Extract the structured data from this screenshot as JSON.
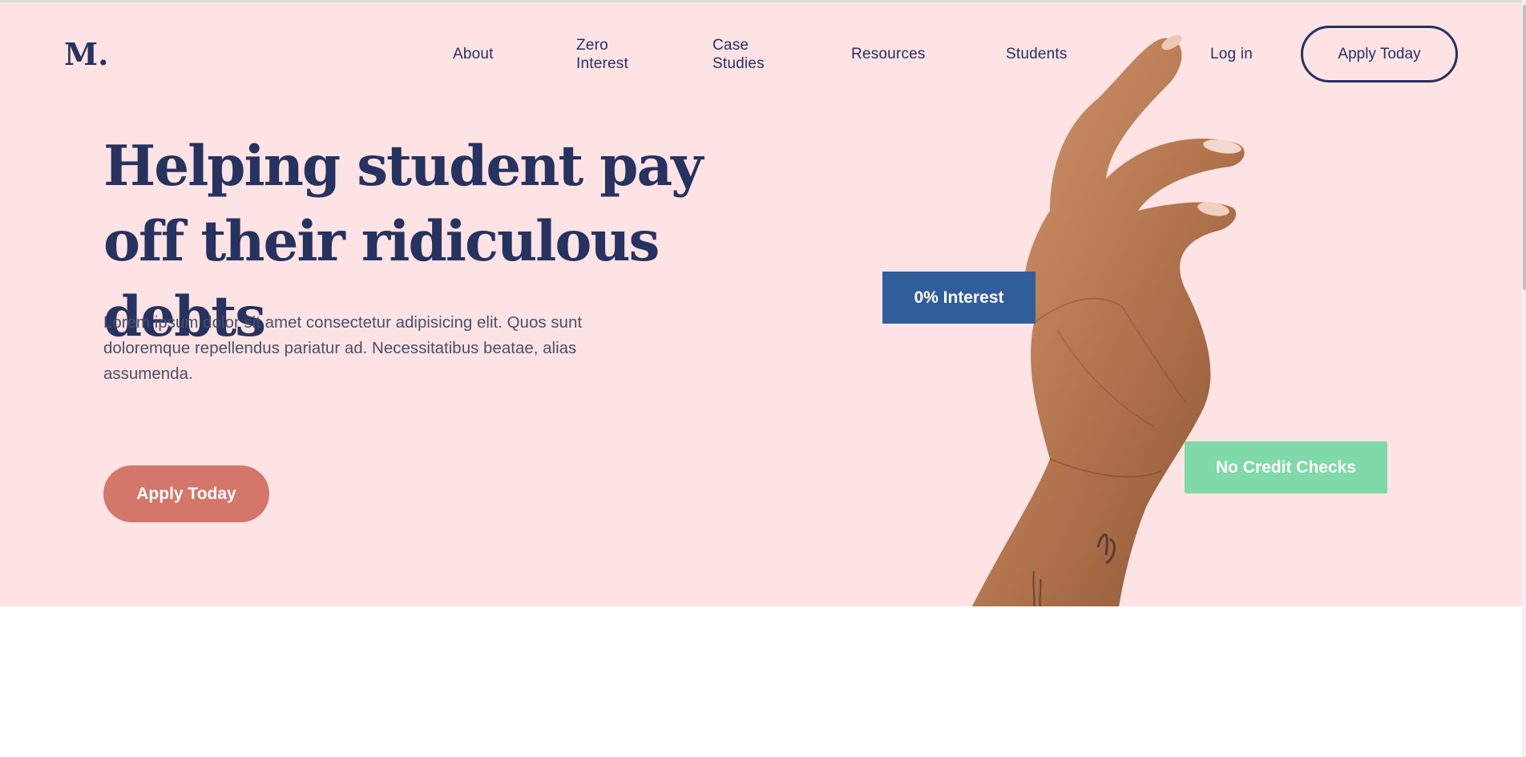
{
  "brand": {
    "logo": "M."
  },
  "nav": {
    "items": [
      {
        "label_lines": [
          "About"
        ]
      },
      {
        "label_lines": [
          "Zero",
          "Interest"
        ]
      },
      {
        "label_lines": [
          "Case",
          "Studies"
        ]
      },
      {
        "label_lines": [
          "Resources"
        ]
      },
      {
        "label_lines": [
          "Students"
        ]
      },
      {
        "label_lines": [
          "Log in"
        ]
      }
    ],
    "apply_label": "Apply Today"
  },
  "hero": {
    "headline_lines": [
      "Helping student pay",
      "off their ridiculous debts"
    ],
    "paragraph": "Lorem ipsum dolor sit amet consectetur adipisicing elit. Quos sunt doloremque repellendus pariatur ad. Necessitatibus beatae, alias assumenda.",
    "cta_label": "Apply Today",
    "badge_interest": "0% Interest",
    "badge_credit": "No Credit Checks",
    "image": "hand-photo"
  },
  "colors": {
    "hero_bg": "#fee3e5",
    "navy": "#26325f",
    "cta": "#d4766a",
    "badge_blue": "#325d9b",
    "badge_green": "#7fd9a8"
  }
}
